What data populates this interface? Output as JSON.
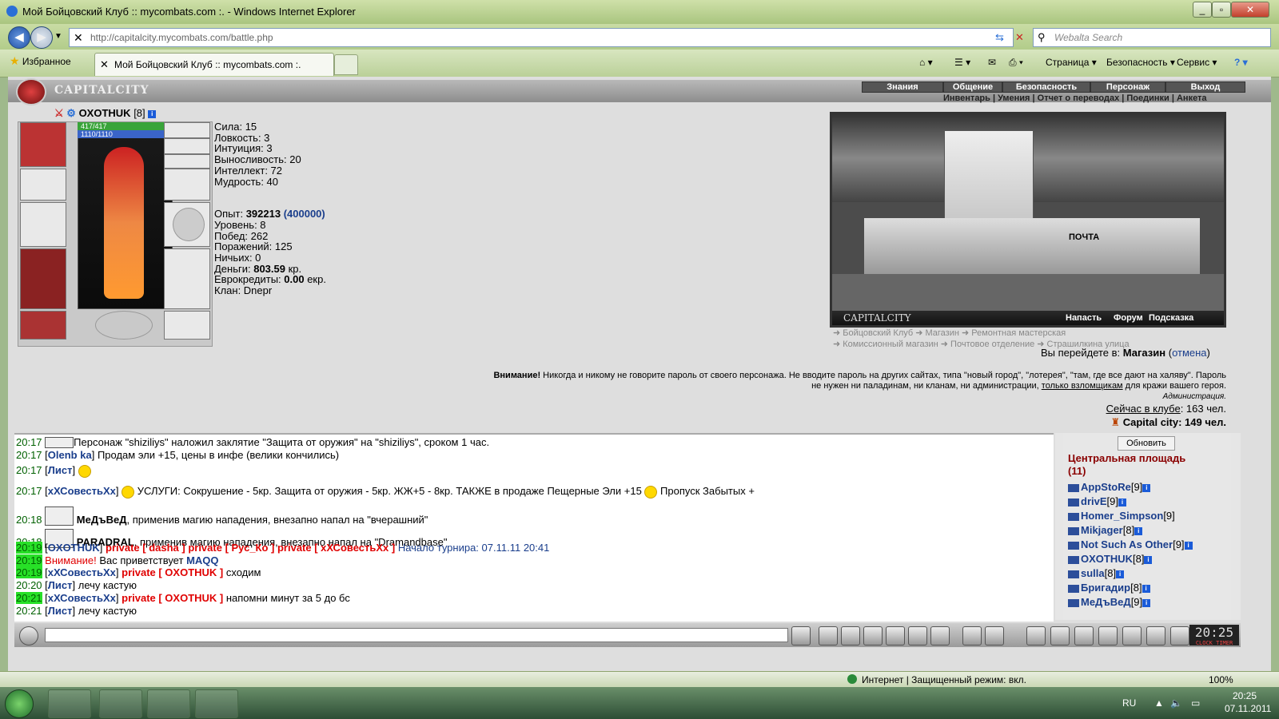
{
  "window": {
    "title": "Мой Бойцовский Клуб :: mycombats.com :. - Windows Internet Explorer"
  },
  "browser": {
    "url": "http://capitalcity.mycombats.com/battle.php",
    "search_placeholder": "Webalta Search",
    "favorites_label": "Избранное",
    "tab_title": "Мой Бойцовский Клуб :: mycombats.com :.",
    "toolbar": {
      "page": "Страница",
      "security": "Безопасность",
      "service": "Сервис"
    }
  },
  "site": {
    "logo": "CAPITALCITY",
    "main_menu": [
      "Знания",
      "Общение",
      "Безопасность",
      "Персонаж",
      "Выход"
    ],
    "sub_menu": "Инвентарь | Умения | Отчет о переводах | Поединки | Анкета"
  },
  "character": {
    "name": "OXOTHUK",
    "level_tag": "[8]",
    "hp": "417/417",
    "mana": "1110/1110",
    "stats": {
      "strength": "Сила: 15",
      "agility": "Ловкость: 3",
      "intuition": "Интуиция: 3",
      "endurance": "Выносливость: 20",
      "intellect": "Интеллект: 72",
      "wisdom": "Мудрость: 40"
    },
    "exp_label": "Опыт: ",
    "exp": "392213",
    "exp_next": "(400000)",
    "level": "Уровень: 8",
    "wins": "Побед: 262",
    "losses": "Поражений: 125",
    "draws": "Ничьих: 0",
    "money_label": "Деньги: ",
    "money": "803.59",
    "money_unit": " кр.",
    "euro_label": "Еврокредиты: ",
    "euro": "0.00",
    "euro_unit": " екр.",
    "clan": "Клан: Dnepr"
  },
  "map": {
    "logo": "CAPITALCITY",
    "sign": "ПОЧТА",
    "links": [
      "Напасть",
      "Форум",
      "Подсказка"
    ],
    "locations_row1": "➜ Бойцовский Клуб  ➜ Магазин  ➜ Ремонтная мастерская",
    "locations_row2": "➜ Комиссионный магазин  ➜ Почтовое отделение  ➜ Страшилкина улица",
    "goto_prefix": "Вы перейдете в: ",
    "goto_place": "Магазин",
    "goto_cancel_open": " (",
    "goto_cancel": "отмена",
    "goto_cancel_close": ")"
  },
  "warning": {
    "title": "Внимание!",
    "text": " Никогда и никому не говорите пароль от своего персонажа. Не вводите пароль на других сайтах, типа \"новый город\", \"лотерея\", \"там, где все дают на халяву\". Пароль не нужен ни паладинам, ни кланам, ни администрации, ",
    "link": "только взломщикам",
    "text2": " для кражи вашего героя.",
    "signature": "Администрация."
  },
  "online": {
    "club_label": "Сейчас в клубе",
    "club_count": ": 163 чел.",
    "city": "Capital city",
    "city_count": ": 149 чел."
  },
  "chat": {
    "lines": [
      {
        "time": "20:17",
        "text": "Персонаж \"shiziliys\" наложил заклятие \"Защита от оружия\" на \"shiziliys\", сроком 1 час."
      },
      {
        "time": "20:17",
        "nick": "Olenb ka",
        "text": " Продам эли +15, цены в инфе (велики кончились)"
      },
      {
        "time": "20:17",
        "nick": "Лист",
        "text": ""
      },
      {
        "time": "20:17",
        "nick": "хХСовестьХх",
        "text": " УСЛУГИ: Сокрушение - 5кр. Защита от оружия - 5кр. ЖЖ+5 - 8кр. ТАКЖЕ в продаже Пещерные Эли +15 ",
        "text2": " Пропуск Забытых +"
      },
      {
        "time": "20:18",
        "nick": "МеДъВеД",
        "text": ", применив магию нападения, внезапно напал на \"вчерашний\""
      },
      {
        "time": "20:18",
        "nick": "PARADRAL",
        "text": ", применив магию нападения, внезапно напал на \"Dramandbase\""
      },
      {
        "time": "20:19",
        "nick": "OXOTHUK",
        "private": "private [ dasha ] private [ Рус_Ко ] private [ хХСовестьХх ]",
        "text": " Начало турнира: 07.11.11 20:41"
      },
      {
        "time": "20:19",
        "warn": "Внимание!",
        "text": " Вас приветствует ",
        "nick": "MAQQ"
      },
      {
        "time": "20:19",
        "nick": "хХСовестьХх",
        "private": "private [ OXOTHUK ]",
        "text": " сходим"
      },
      {
        "time": "20:20",
        "nick": "Лист",
        "text": " лечу кастую"
      },
      {
        "time": "20:21",
        "nick": "хХСовестьХх",
        "private": "private [ OXOTHUK ]",
        "text": " напомни минут за 5 до бс"
      },
      {
        "time": "20:21",
        "nick": "Лист",
        "text": " лечу кастую"
      }
    ]
  },
  "userlist": {
    "refresh": "Обновить",
    "room": "Центральная площадь",
    "room_count": "(11)",
    "users": [
      {
        "name": "AppStoRe",
        "lvl": "[9]"
      },
      {
        "name": "drivE",
        "lvl": "[9]"
      },
      {
        "name": "Homer_Simpson",
        "lvl": "[9]"
      },
      {
        "name": "Mikjager",
        "lvl": "[8]"
      },
      {
        "name": "Not Such As Other",
        "lvl": "[9]"
      },
      {
        "name": "OXOTHUK",
        "lvl": "[8]"
      },
      {
        "name": "sulla",
        "lvl": "[8]"
      },
      {
        "name": "Бригадир",
        "lvl": "[8]"
      },
      {
        "name": "МеДъВеД",
        "lvl": "[9]"
      }
    ]
  },
  "bottom": {
    "clock": "20:25",
    "clock_label": "CLOCK TIMER"
  },
  "statusbar": {
    "zone": "Интернет | Защищенный режим: вкл.",
    "zoom": "100%"
  },
  "taskbar": {
    "lang": "RU",
    "time": "20:25",
    "date": "07.11.2011"
  },
  "colors": {
    "accent": "#1a3e8c",
    "private": "#e00000",
    "time": "#006000",
    "room": "#8a0000"
  }
}
